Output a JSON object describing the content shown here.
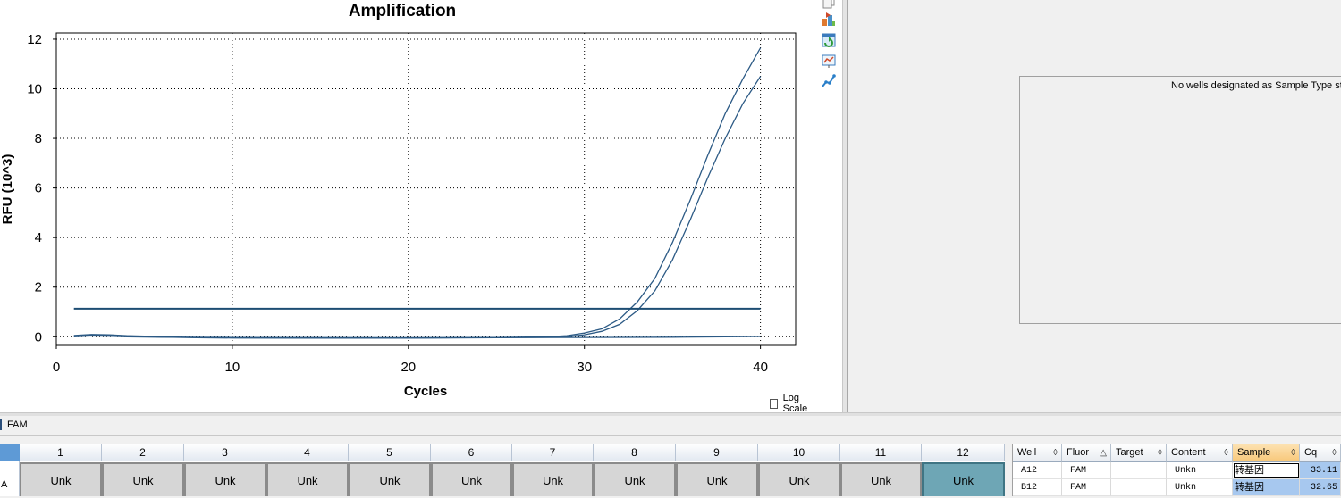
{
  "colors": {
    "curve": "#2c5a85",
    "threshold": "#1d4d73",
    "selected_well": "#6ea6b5",
    "well": "#d6d6d6",
    "selection": "#a7c8ef",
    "sorted_header": "#f8c87a"
  },
  "chart_data": {
    "type": "line",
    "title": "Amplification",
    "xlabel": "Cycles",
    "ylabel": "RFU (10^3)",
    "xlim": [
      0,
      42
    ],
    "ylim": [
      -0.35,
      12.25
    ],
    "xticks": [
      0,
      10,
      20,
      30,
      40
    ],
    "yticks": [
      0,
      2,
      4,
      6,
      8,
      10,
      12
    ],
    "grid": true,
    "grid_style": "dotted",
    "log_scale": false,
    "threshold": 1.13,
    "series": [
      {
        "x": [
          1,
          2,
          3,
          4,
          5,
          6,
          8,
          10,
          15,
          20,
          25,
          28,
          29,
          30,
          31,
          32,
          33,
          34,
          35,
          36,
          37,
          38,
          39,
          40
        ],
        "y": [
          0.05,
          0.09,
          0.08,
          0.04,
          0.02,
          0.0,
          -0.03,
          -0.04,
          -0.05,
          -0.05,
          -0.03,
          0.0,
          0.04,
          0.15,
          0.32,
          0.72,
          1.4,
          2.35,
          3.8,
          5.5,
          7.3,
          9.0,
          10.4,
          11.65
        ]
      },
      {
        "x": [
          1,
          2,
          3,
          4,
          5,
          6,
          8,
          10,
          15,
          20,
          25,
          28,
          29,
          30,
          31,
          32,
          33,
          34,
          35,
          36,
          37,
          38,
          39,
          40
        ],
        "y": [
          0.02,
          0.05,
          0.06,
          0.03,
          0.01,
          -0.01,
          -0.04,
          -0.05,
          -0.06,
          -0.06,
          -0.04,
          -0.02,
          0.0,
          0.08,
          0.22,
          0.5,
          1.05,
          1.85,
          3.1,
          4.7,
          6.4,
          8.0,
          9.4,
          10.5
        ]
      },
      {
        "x": [
          1,
          2,
          3,
          4,
          6,
          10,
          20,
          30,
          35,
          38,
          40
        ],
        "y": [
          0.0,
          0.03,
          0.02,
          0.0,
          -0.02,
          -0.03,
          -0.04,
          -0.03,
          -0.02,
          0.0,
          0.01
        ]
      }
    ]
  },
  "chart_controls": {
    "log_scale_label": "Log Scale"
  },
  "standard_curve": {
    "message": "No wells designated as Sample Type sta"
  },
  "toolbar": {
    "icons": [
      "copy-icon",
      "export-icon",
      "refresh-icon",
      "chart-settings-icon",
      "curve-icon"
    ]
  },
  "fluorophore_bar": {
    "label": "FAM"
  },
  "plate": {
    "row_label": "A",
    "columns": [
      "1",
      "2",
      "3",
      "4",
      "5",
      "6",
      "7",
      "8",
      "9",
      "10",
      "11",
      "12"
    ],
    "wells": [
      "Unk",
      "Unk",
      "Unk",
      "Unk",
      "Unk",
      "Unk",
      "Unk",
      "Unk",
      "Unk",
      "Unk",
      "Unk",
      "Unk"
    ],
    "selected_col": 12
  },
  "grid": {
    "headers": [
      "Well",
      "Fluor",
      "Target",
      "Content",
      "Sample",
      "Cq"
    ],
    "sort_glyphs": [
      "◊",
      "△",
      "◊",
      "◊",
      "◊",
      "◊"
    ],
    "rows": [
      {
        "well": "A12",
        "fluor": "FAM",
        "target": "",
        "content": "Unkn",
        "sample": "转基因",
        "cq": "33.11"
      },
      {
        "well": "B12",
        "fluor": "FAM",
        "target": "",
        "content": "Unkn",
        "sample": "转基因",
        "cq": "32.65"
      }
    ]
  }
}
